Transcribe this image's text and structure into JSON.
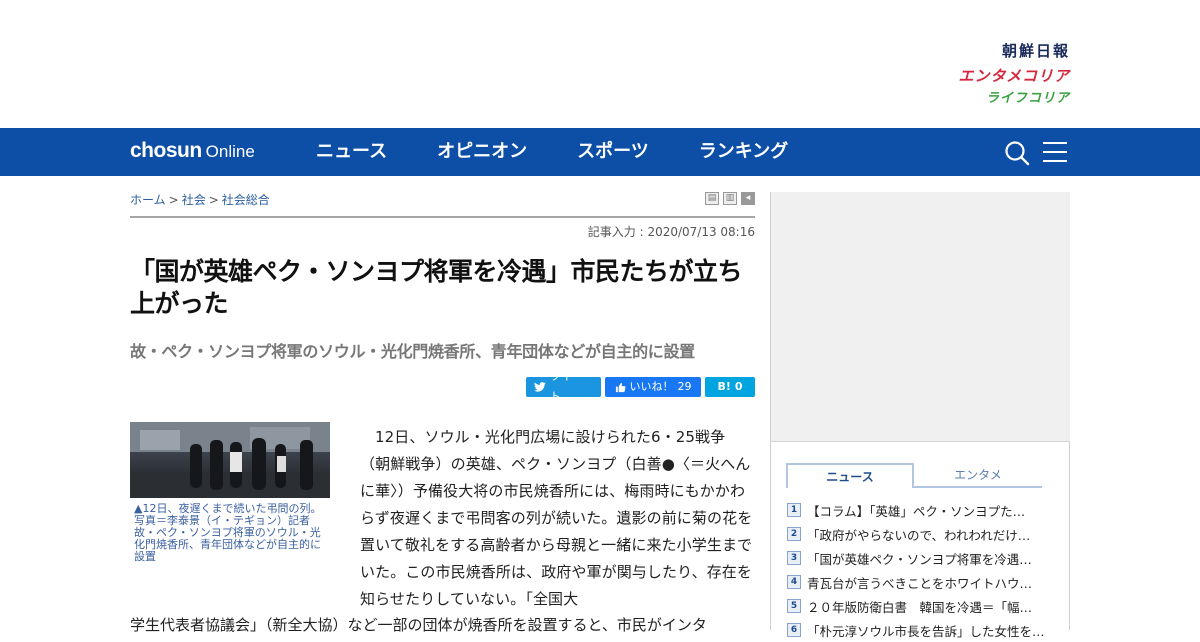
{
  "brands": {
    "main": "朝鮮日報",
    "entertainment": "エンタメコリア",
    "life": "ライフコリア"
  },
  "logo": {
    "bold": "chosun",
    "light": "Online"
  },
  "nav": {
    "items": [
      "ニュース",
      "オピニオン",
      "スポーツ",
      "ランキング"
    ]
  },
  "breadcrumb": {
    "home": "ホーム",
    "sep": ">",
    "cat1": "社会",
    "cat2": "社会総合"
  },
  "article": {
    "date": "記事入力 : 2020/07/13 08:16",
    "title": "「国が英雄ペク・ソンヨプ将軍を冷遇」市民たちが立ち上がった",
    "subtitle": "故・ペク・ソンヨプ将軍のソウル・光化門焼香所、青年団体などが自主的に設置",
    "caption": "▲12日、夜遅くまで続いた弔問の列。写真＝李泰景（イ・テギョン）記者 故・ペク・ソンヨプ将軍のソウル・光化門焼香所、青年団体などが自主的に設置",
    "body": "12日、ソウル・光化門広場に設けられた6・25戦争（朝鮮戦争）の英雄、ペク・ソンヨプ（白善●〈＝火へんに華〉）予備役大将の市民焼香所には、梅雨時にもかかわらず夜遅くまで弔問客の列が続いた。遺影の前に菊の花を置いて敬礼をする高齢者から母親と一緒に来た小学生までいた。この市民焼香所は、政府や軍が関与したり、存在を知らせたりしていない。「全国大",
    "body_cont": "学生代表者協議会」（新全大協）など一部の団体が焼香所を設置すると、市民がインタ"
  },
  "share": {
    "tweet": "ツイート",
    "like": "いいね！",
    "like_count": "29",
    "hatena_label": "B!",
    "hatena_count": "0"
  },
  "sidebar": {
    "tabs": [
      "ニュース",
      "エンタメ"
    ],
    "ranking": [
      {
        "num": "1",
        "text": "【コラム】「英雄」ペク・ソンヨプた…"
      },
      {
        "num": "2",
        "text": "「政府がやらないので、われわれだけ…"
      },
      {
        "num": "3",
        "text": "「国が英雄ペク・ソンヨプ将軍を冷遇…"
      },
      {
        "num": "4",
        "text": "青瓦台が言うべきことをホワイトハウ…"
      },
      {
        "num": "5",
        "text": "２０年版防衛白書　韓国を冷遇＝「幅…"
      },
      {
        "num": "6",
        "text": "「朴元淳ソウル市長を告訴」した女性を…"
      }
    ]
  }
}
